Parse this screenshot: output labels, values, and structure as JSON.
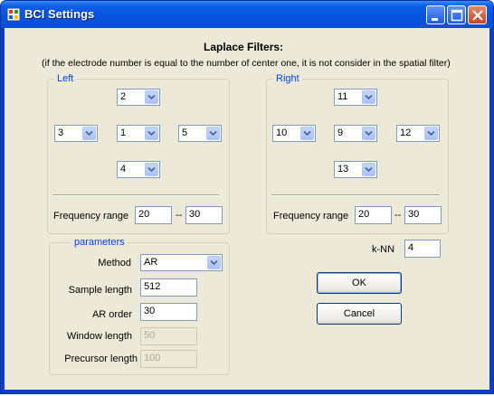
{
  "window": {
    "title": "BCI Settings"
  },
  "header": {
    "title": "Laplace Filters:",
    "note": "(if the electrode number is equal to the number of center one, it is not consider in the spatial filter)"
  },
  "left": {
    "label": "Left",
    "top": "2",
    "west": "3",
    "center": "1",
    "east": "5",
    "bottom": "4",
    "freq_label": "Frequency range",
    "freq_from": "20",
    "freq_sep": "--",
    "freq_to": "30"
  },
  "right": {
    "label": "Right",
    "top": "11",
    "west": "10",
    "center": "9",
    "east": "12",
    "bottom": "13",
    "freq_label": "Frequency range",
    "freq_from": "20",
    "freq_sep": "--",
    "freq_to": "30"
  },
  "params": {
    "label": "parameters",
    "method_label": "Method",
    "method_value": "AR",
    "sample_length_label": "Sample length",
    "sample_length_value": "512",
    "ar_order_label": "AR order",
    "ar_order_value": "30",
    "window_length_label": "Window length",
    "window_length_value": "50",
    "precursor_length_label": "Precursor length",
    "precursor_length_value": "100"
  },
  "knn": {
    "label": "k-NN",
    "value": "4"
  },
  "buttons": {
    "ok": "OK",
    "cancel": "Cancel"
  },
  "icons": [
    "app-icon",
    "minimize-icon",
    "maximize-icon",
    "close-icon",
    "dropdown-arrow-icon"
  ],
  "colors": {
    "titlebar": "#0553e0",
    "face": "#ece9d8",
    "group_label": "#0046d5"
  }
}
